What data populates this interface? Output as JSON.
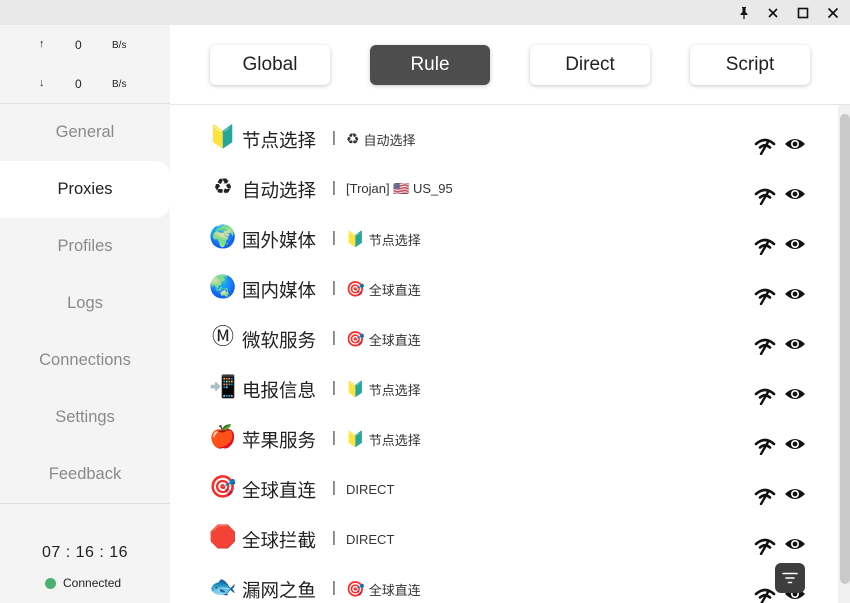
{
  "titlebar": {
    "buttons": [
      {
        "name": "pin-icon",
        "glyph": "📌"
      },
      {
        "name": "minimize-icon",
        "glyph": "✕"
      },
      {
        "name": "maximize-icon",
        "glyph": "☐"
      },
      {
        "name": "close-icon",
        "glyph": "✕"
      }
    ]
  },
  "traffic": {
    "up": {
      "arrow": "↑",
      "value": "0",
      "unit": "B/s"
    },
    "down": {
      "arrow": "↓",
      "value": "0",
      "unit": "B/s"
    }
  },
  "nav": {
    "items": [
      {
        "label": "General",
        "active": false
      },
      {
        "label": "Proxies",
        "active": true
      },
      {
        "label": "Profiles",
        "active": false
      },
      {
        "label": "Logs",
        "active": false
      },
      {
        "label": "Connections",
        "active": false
      },
      {
        "label": "Settings",
        "active": false
      },
      {
        "label": "Feedback",
        "active": false
      }
    ]
  },
  "status": {
    "clock": "07 : 16 : 16",
    "connection": "Connected",
    "dot_color": "#4caf72"
  },
  "modes": [
    {
      "label": "Global",
      "active": false
    },
    {
      "label": "Rule",
      "active": true
    },
    {
      "label": "Direct",
      "active": false
    },
    {
      "label": "Script",
      "active": false
    }
  ],
  "groups": [
    {
      "emoji": "🔰",
      "name": "节点选择",
      "separator": "|",
      "selected_emoji": "♻",
      "selected": "自动选择"
    },
    {
      "emoji": "♻",
      "name": "自动选择",
      "separator": "|",
      "selected_emoji": "",
      "selected": "[Trojan] 🇺🇸 US_95"
    },
    {
      "emoji": "🌍",
      "name": "国外媒体",
      "separator": "|",
      "selected_emoji": "🔰",
      "selected": "节点选择"
    },
    {
      "emoji": "🌏",
      "name": "国内媒体",
      "separator": "|",
      "selected_emoji": "🎯",
      "selected": "全球直连"
    },
    {
      "emoji": "Ⓜ",
      "name": "微软服务",
      "separator": "|",
      "selected_emoji": "🎯",
      "selected": "全球直连"
    },
    {
      "emoji": "📲",
      "name": "电报信息",
      "separator": "|",
      "selected_emoji": "🔰",
      "selected": "节点选择"
    },
    {
      "emoji": "🍎",
      "name": "苹果服务",
      "separator": "|",
      "selected_emoji": "🔰",
      "selected": "节点选择"
    },
    {
      "emoji": "🎯",
      "name": "全球直连",
      "separator": "|",
      "selected_emoji": "",
      "selected": "DIRECT"
    },
    {
      "emoji": "🛑",
      "name": "全球拦截",
      "separator": "|",
      "selected_emoji": "",
      "selected": "DIRECT"
    },
    {
      "emoji": "🐟",
      "name": "漏网之鱼",
      "separator": "|",
      "selected_emoji": "🎯",
      "selected": "全球直连"
    }
  ],
  "colors": {
    "sidebar_bg": "#f4f4f4",
    "active_mode_bg": "#4d4d4d",
    "fab_bg": "#3d3d3d"
  }
}
